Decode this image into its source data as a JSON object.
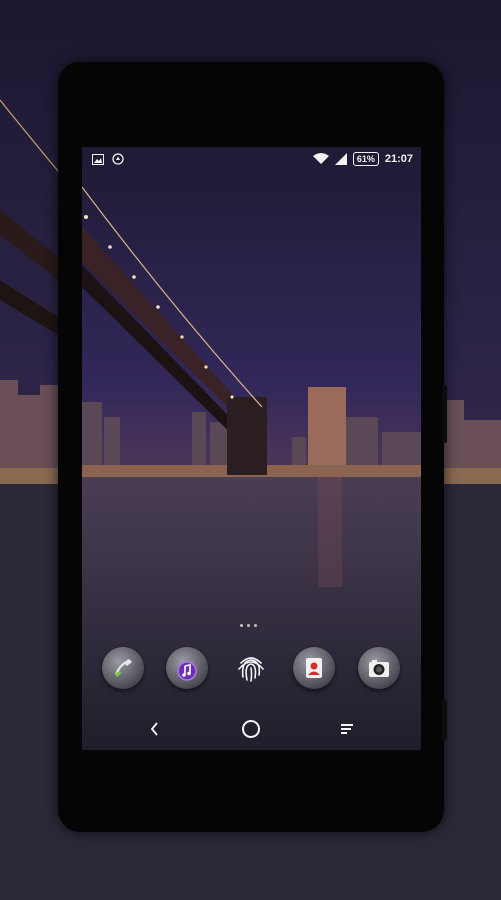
{
  "status_bar": {
    "battery": "61%",
    "time": "21:07"
  },
  "home_screen": {
    "page_indicator_dots": 3,
    "dock": [
      "phone-icon",
      "music-icon",
      "fingerprint-icon",
      "contacts-icon",
      "camera-icon"
    ]
  },
  "nav_bar": [
    "back-icon",
    "home-icon",
    "recents-icon"
  ],
  "colors": {
    "sky": "#2b2346",
    "water": "#3a3346",
    "phone_body": "#050505",
    "status_text": "#f2f2f2"
  }
}
